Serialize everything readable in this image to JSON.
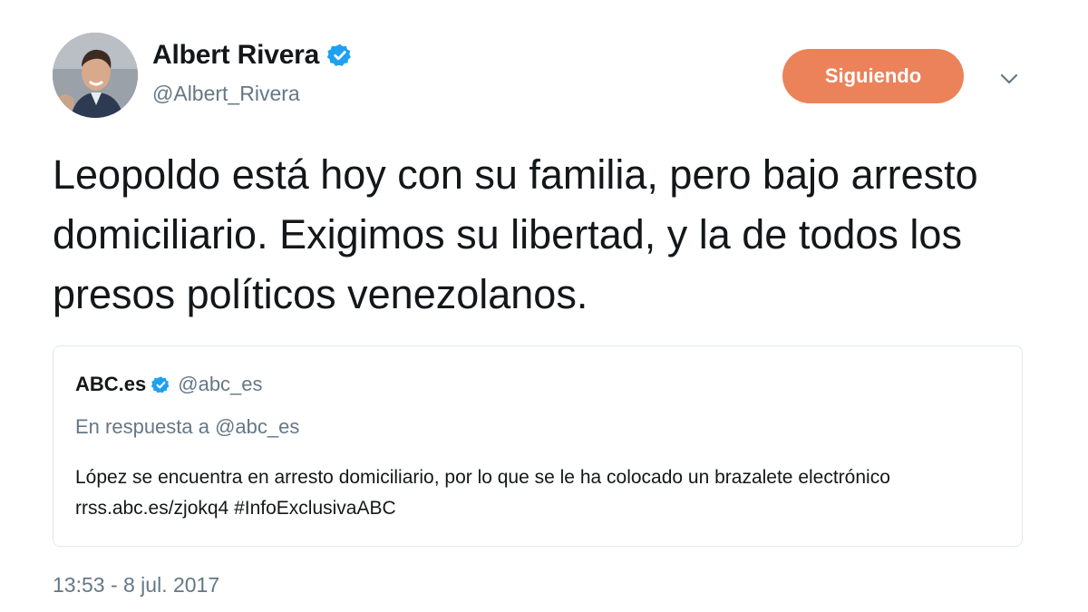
{
  "author": {
    "display_name": "Albert Rivera",
    "handle": "@Albert_Rivera",
    "verified": true,
    "avatar_icon": "profile-photo"
  },
  "follow_button": {
    "label": "Siguiendo",
    "color": "#ec8259"
  },
  "menu": {
    "icon": "chevron-down-icon"
  },
  "tweet": {
    "text": "Leopoldo está hoy con su familia, pero bajo arresto domiciliario. Exigimos su libertad, y la de todos los presos políticos venezolanos.",
    "timestamp": "13:53 - 8 jul. 2017"
  },
  "quoted_tweet": {
    "display_name": "ABC.es",
    "handle": "@abc_es",
    "verified": true,
    "reply_to": "En respuesta a @abc_es",
    "text": "López se encuentra en arresto domiciliario, por lo que se le ha colocado un brazalete electrónico rrss.abc.es/zjokq4 #InfoExclusivaABC"
  },
  "colors": {
    "verified_badge": "#1da1f2",
    "secondary_text": "#657786",
    "border": "#e1e8ed"
  }
}
